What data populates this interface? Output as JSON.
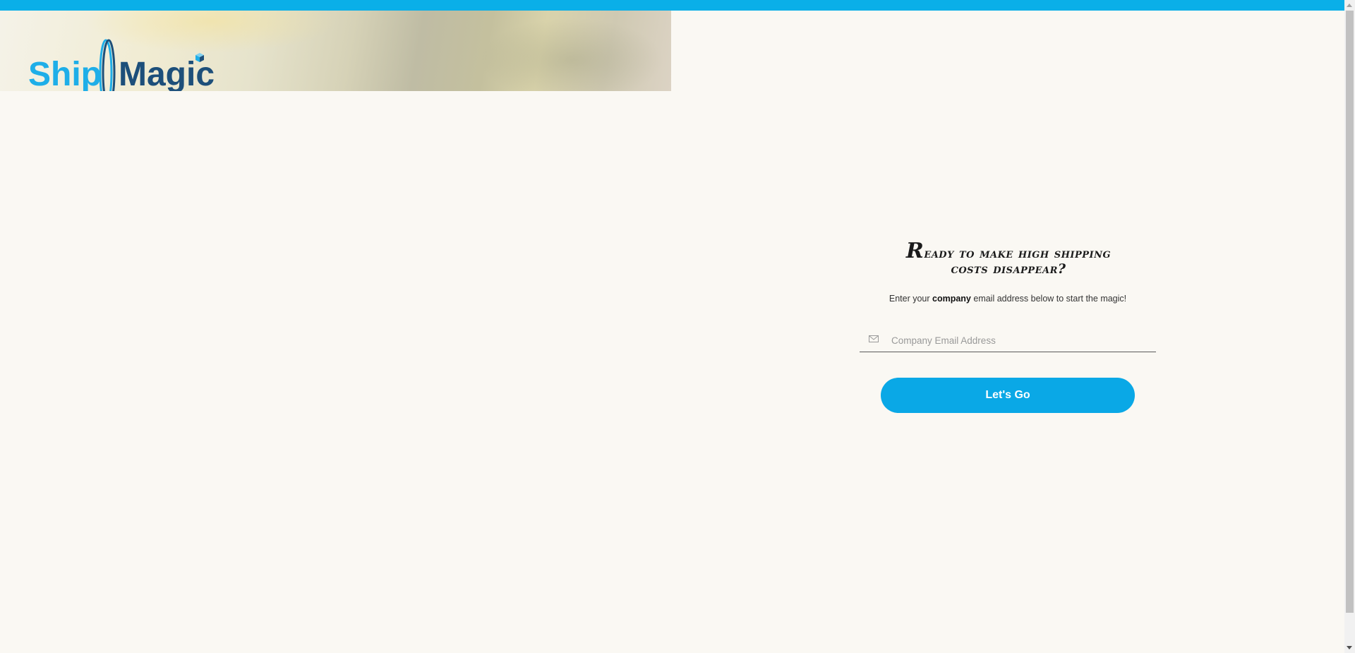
{
  "brand": {
    "part1": "Ship",
    "part2": "Magic",
    "colors": {
      "accent_light": "#1eaee8",
      "accent_dark": "#1d4f7a",
      "top_bar": "#0aafe8",
      "button": "#0aa8e6",
      "background": "#faf8f3"
    }
  },
  "signup": {
    "headline_line1": "Ready to make high shipping",
    "headline_line2": "costs disappear?",
    "subtitle_before": "Enter your ",
    "subtitle_bold": "company",
    "subtitle_after": " email address below to start the magic!",
    "email_placeholder": "Company Email Address",
    "email_value": "",
    "email_icon": "envelope-icon",
    "submit_label": "Let's Go"
  }
}
